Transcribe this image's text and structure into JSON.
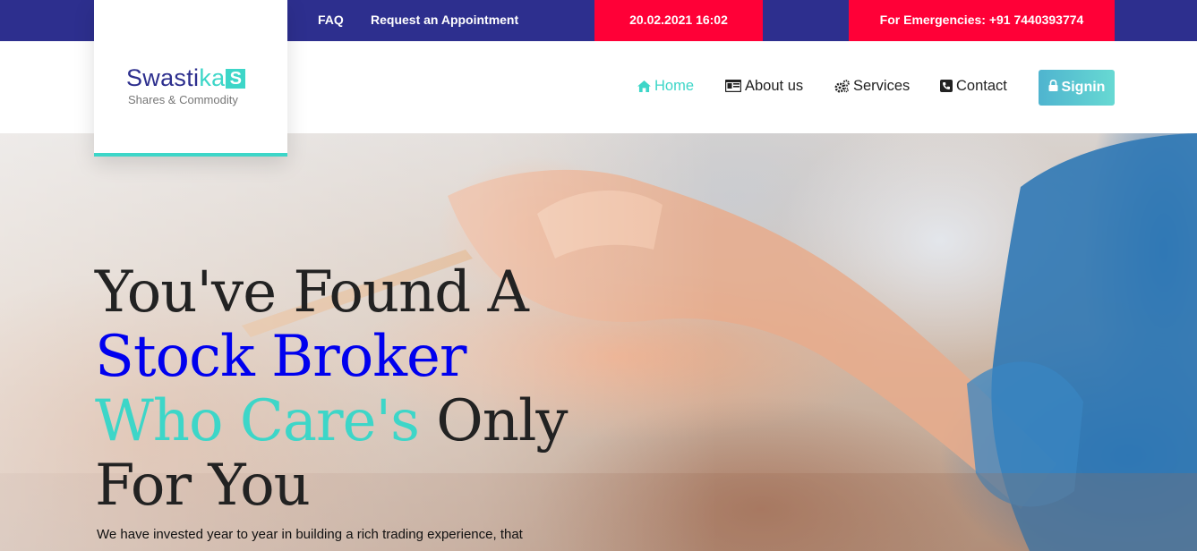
{
  "topbar": {
    "faq": "FAQ",
    "appointment": "Request an Appointment",
    "datetime": "20.02.2021 16:02",
    "emergency": "For Emergencies: +91 7440393774"
  },
  "logo": {
    "title_a": "Swast",
    "title_b": "ka",
    "title_i": "i",
    "mark": "S",
    "subtitle": "Shares & Commodity"
  },
  "nav": {
    "home": "Home",
    "about": "About us",
    "services": "Services",
    "contact": "Contact",
    "signin": "Signin"
  },
  "hero": {
    "line1": "You've Found A",
    "line2": "Stock Broker",
    "line3a": "Who Care's",
    "line3b": " Only",
    "line4": "For You",
    "text": "We have invested year to year in building a rich trading experience, that"
  },
  "colors": {
    "navy": "#2d2f8e",
    "red": "#ff0037",
    "teal": "#3dd6c8",
    "blue": "#0000ee"
  }
}
